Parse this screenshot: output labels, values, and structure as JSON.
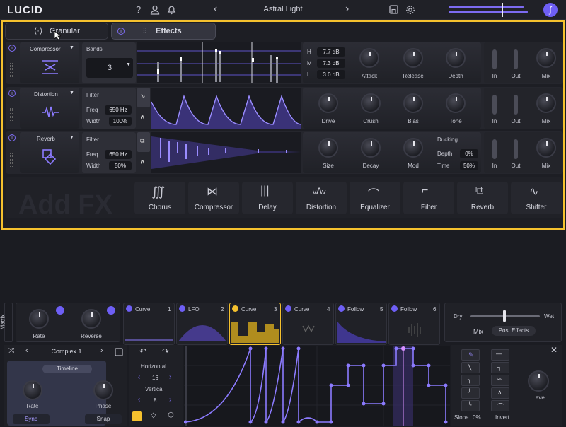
{
  "app": {
    "logo": "LUCID",
    "preset": "Astral Light"
  },
  "topbar": {
    "help": "?",
    "user_icon": "user-icon",
    "bell_icon": "bell-icon",
    "prev": "‹",
    "next": "›",
    "save_icon": "save-icon",
    "gear_icon": "gear-icon"
  },
  "tabs": {
    "granular": "Granular",
    "effects": "Effects"
  },
  "compressor": {
    "name": "Compressor",
    "bands_label": "Bands",
    "bands_value": "3",
    "h_label": "H",
    "h_val": "7.7 dB",
    "m_label": "M",
    "m_val": "7.3 dB",
    "l_label": "L",
    "l_val": "3.0 dB",
    "knobs": [
      "Attack",
      "Release",
      "Depth"
    ],
    "in": "In",
    "out": "Out",
    "mix": "Mix"
  },
  "distortion": {
    "name": "Distortion",
    "filter_label": "Filter",
    "freq_label": "Freq",
    "freq_val": "650 Hz",
    "width_label": "Width",
    "width_val": "100%",
    "knobs": [
      "Drive",
      "Crush",
      "Bias",
      "Tone"
    ],
    "in": "In",
    "out": "Out",
    "mix": "Mix"
  },
  "reverb": {
    "name": "Reverb",
    "filter_label": "Filter",
    "freq_label": "Freq",
    "freq_val": "650 Hz",
    "width_label": "Width",
    "width_val": "50%",
    "knobs": [
      "Size",
      "Decay",
      "Mod"
    ],
    "ducking_label": "Ducking",
    "depth_label": "Depth",
    "depth_val": "0%",
    "time_label": "Time",
    "time_val": "50%",
    "in": "In",
    "out": "Out",
    "mix": "Mix"
  },
  "addfx": {
    "watermark": "Add FX",
    "tiles": [
      "Chorus",
      "Compressor",
      "Delay",
      "Distortion",
      "Equalizer",
      "Filter",
      "Reverb",
      "Shifter"
    ]
  },
  "matrix": {
    "label": "Matrix",
    "rate": "Rate",
    "reverse": "Reverse"
  },
  "modtabs": [
    {
      "name": "Curve",
      "num": "1"
    },
    {
      "name": "LFO",
      "num": "2"
    },
    {
      "name": "Curve",
      "num": "3"
    },
    {
      "name": "Curve",
      "num": "4"
    },
    {
      "name": "Follow",
      "num": "5"
    },
    {
      "name": "Follow",
      "num": "6"
    }
  ],
  "drywet": {
    "dry": "Dry",
    "wet": "Wet",
    "mix": "Mix",
    "post": "Post Effects"
  },
  "curve": {
    "preset": "Complex 1",
    "timeline": "Timeline",
    "rate": "Rate",
    "phase": "Phase",
    "sync": "Sync",
    "snap": "Snap",
    "horizontal": "Horizontal",
    "h_val": "16",
    "vertical": "Vertical",
    "v_val": "8",
    "slope": "Slope",
    "slope_val": "0%",
    "invert": "Invert",
    "level": "Level"
  },
  "colors": {
    "accent": "#7c6bf0",
    "highlight": "#f5c12e",
    "bg": "#1b1c22"
  }
}
